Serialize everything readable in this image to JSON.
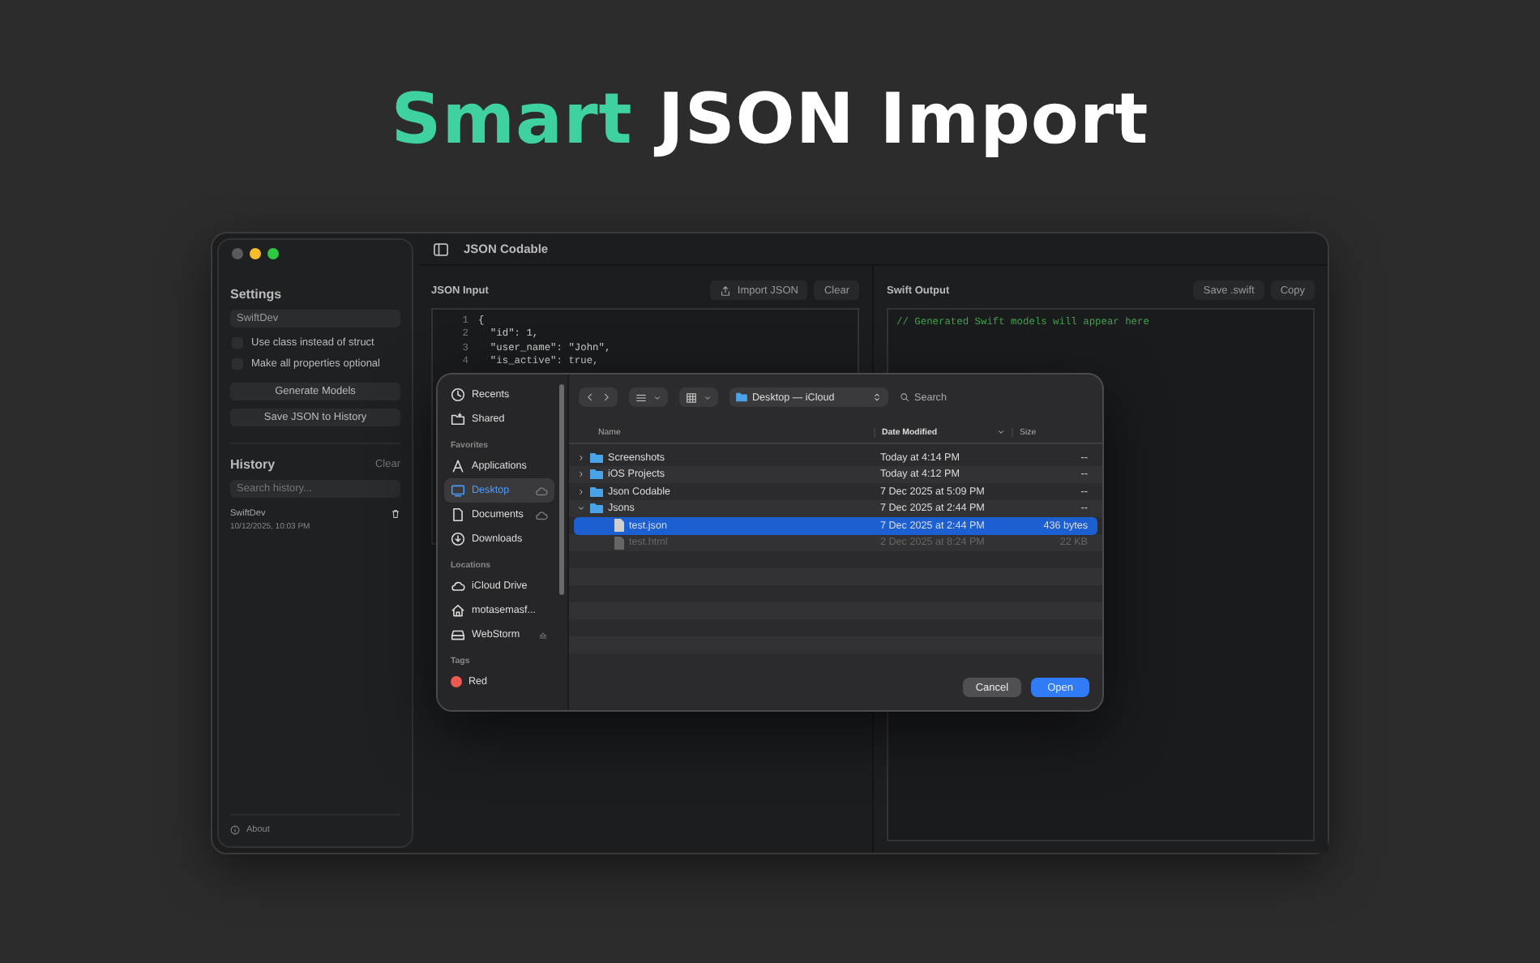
{
  "headline": {
    "accent": "Smart",
    "rest": "JSON Import"
  },
  "window": {
    "title": "JSON Codable"
  },
  "settings": {
    "title": "Settings",
    "name_field": {
      "value": "SwiftDev"
    },
    "options": [
      {
        "label": "Use class instead of struct",
        "checked": false
      },
      {
        "label": "Make all properties optional",
        "checked": false
      }
    ],
    "buttons": [
      "Generate Models",
      "Save JSON to History"
    ]
  },
  "history": {
    "title": "History",
    "clear": "Clear",
    "search": {
      "placeholder": "Search history..."
    },
    "entries": [
      {
        "name": "SwiftDev",
        "date": "10/12/2025, 10:03 PM"
      }
    ]
  },
  "about": "About",
  "json_input": {
    "title": "JSON Input",
    "import_button": "Import JSON",
    "clear_button": "Clear",
    "lines": [
      {
        "number": "1",
        "text": "{"
      },
      {
        "number": "2",
        "text": "  \"id\": 1,"
      },
      {
        "number": "3",
        "text": "  \"user_name\": \"John\","
      },
      {
        "number": "4",
        "text": "  \"is_active\": true,"
      }
    ]
  },
  "swift_output": {
    "title": "Swift Output",
    "buttons": [
      "Save .swift",
      "Copy"
    ],
    "text": "// Generated Swift models will appear here"
  },
  "file_dialog": {
    "sidebar": [
      {
        "items": [
          {
            "label": "Recents",
            "kind": "recents",
            "selected": false
          },
          {
            "label": "Shared",
            "kind": "shared",
            "selected": false
          }
        ]
      },
      {
        "heading": "Favorites",
        "items": [
          {
            "label": "Applications",
            "kind": "applications",
            "selected": false
          },
          {
            "label": "Desktop",
            "kind": "desktop",
            "selected": true
          },
          {
            "label": "Documents",
            "kind": "document",
            "selected": false
          },
          {
            "label": "Downloads",
            "kind": "downloads",
            "selected": false
          }
        ]
      },
      {
        "heading": "Locations",
        "items": [
          {
            "label": "iCloud Drive",
            "kind": "cloud",
            "selected": false
          },
          {
            "label": "motasemasf...",
            "kind": "home",
            "selected": false
          },
          {
            "label": "WebStorm",
            "kind": "drive",
            "selected": false
          }
        ]
      },
      {
        "heading": "Tags",
        "items": [
          {
            "label": "Red",
            "kind": "tag",
            "selected": false,
            "color": "#ec5b52"
          }
        ]
      }
    ],
    "location": "Desktop — iCloud",
    "search": {
      "placeholder": "Search"
    },
    "columns": [
      {
        "label": "Name",
        "sorted": false
      },
      {
        "label": "Date Modified",
        "sorted": true
      },
      {
        "label": "Size",
        "sorted": false
      }
    ],
    "rows": [
      {
        "name": "Screenshots",
        "kind": "folder",
        "date": "Today at 4:14 PM",
        "size": "--",
        "expanded": false,
        "selected": false,
        "disabled": false
      },
      {
        "name": "iOS Projects",
        "kind": "folder",
        "date": "Today at 4:12 PM",
        "size": "--",
        "expanded": false,
        "selected": false,
        "disabled": false
      },
      {
        "name": "Json Codable",
        "kind": "folder",
        "date": "7 Dec 2025 at 5:09 PM",
        "size": "--",
        "expanded": false,
        "selected": false,
        "disabled": false
      },
      {
        "name": "Jsons",
        "kind": "folder",
        "date": "7 Dec 2025 at 2:44 PM",
        "size": "--",
        "expanded": true,
        "selected": false,
        "disabled": false,
        "children": [
          {
            "name": "test.json",
            "kind": "file",
            "date": "7 Dec 2025 at 2:44 PM",
            "size": "436 bytes",
            "selected": true,
            "disabled": false
          },
          {
            "name": "test.html",
            "kind": "file",
            "date": "2 Dec 2025 at 8:24 PM",
            "size": "22 KB",
            "selected": false,
            "disabled": true
          }
        ]
      }
    ],
    "buttons": [
      {
        "label": "Cancel",
        "primary": false
      },
      {
        "label": "Open",
        "primary": true
      }
    ]
  }
}
